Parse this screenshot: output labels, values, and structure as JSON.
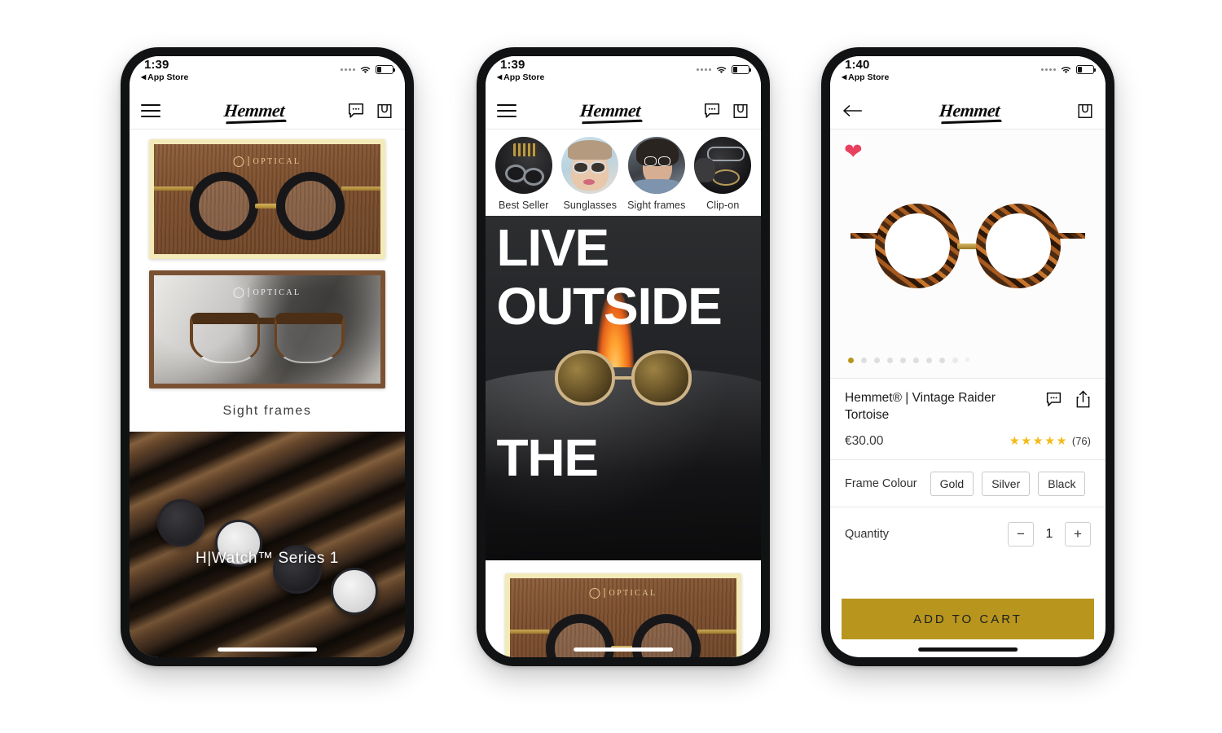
{
  "brand": {
    "name": "Hemmet",
    "logo_text": "Hemmet"
  },
  "phones": [
    {
      "id": "phone-home",
      "status": {
        "time": "1:39",
        "back_label": "App Store",
        "back_arrow": "◀"
      },
      "appbar": {
        "menu_icon": "hamburger-icon",
        "logo": "Hemmet",
        "chat_icon": "chat-bubble-icon",
        "bag_icon": "shopping-bag-icon"
      },
      "cards": [
        {
          "name": "black-round-frames-card",
          "watermark": "OPTICAL",
          "border": "#f4eab7"
        },
        {
          "name": "tortoise-browline-frames-card",
          "watermark": "OPTICAL",
          "border": "#7b5133"
        }
      ],
      "section_label": "Sight frames",
      "banner": {
        "title": "H|Watch™ Series 1"
      }
    },
    {
      "id": "phone-category",
      "status": {
        "time": "1:39",
        "back_label": "App Store",
        "back_arrow": "◀"
      },
      "appbar": {
        "menu_icon": "hamburger-icon",
        "logo": "Hemmet",
        "chat_icon": "chat-bubble-icon",
        "bag_icon": "shopping-bag-icon"
      },
      "categories": [
        {
          "label": "Best Seller",
          "thumb": "sunglasses-flatlay-thumb"
        },
        {
          "label": "Sunglasses",
          "thumb": "woman-hat-sunglasses-thumb"
        },
        {
          "label": "Sight frames",
          "thumb": "woman-eyeglasses-thumb"
        },
        {
          "label": "Clip-on",
          "thumb": "hand-holding-clipon-thumb"
        }
      ],
      "hero": {
        "line1": "LIVE",
        "line2": "OUTSIDE",
        "line3": "THE"
      },
      "bottom_card": {
        "watermark": "OPTICAL"
      }
    },
    {
      "id": "phone-product",
      "status": {
        "time": "1:40",
        "back_label": "App Store",
        "back_arrow": "◀"
      },
      "appbar": {
        "back_icon": "arrow-left-icon",
        "logo": "Hemmet",
        "bag_icon": "shopping-bag-icon"
      },
      "wishlist": {
        "icon": "heart-icon",
        "color": "#e8415e",
        "active": true
      },
      "gallery": {
        "image": "vintage-raider-tortoise-glasses",
        "dot_count": 10,
        "active_dot": 0
      },
      "product": {
        "title": "Hemmet® | Vintage Raider Tortoise",
        "price": "€30.00",
        "stars": "★★★★★",
        "review_count": "(76)",
        "chat_icon": "chat-bubble-icon",
        "share_icon": "share-icon"
      },
      "options": {
        "label": "Frame Colour",
        "values": [
          "Gold",
          "Silver",
          "Black"
        ]
      },
      "quantity": {
        "label": "Quantity",
        "value": "1",
        "minus": "−",
        "plus": "+"
      },
      "cta": {
        "label": "ADD TO CART",
        "color": "#b8961e"
      }
    }
  ]
}
